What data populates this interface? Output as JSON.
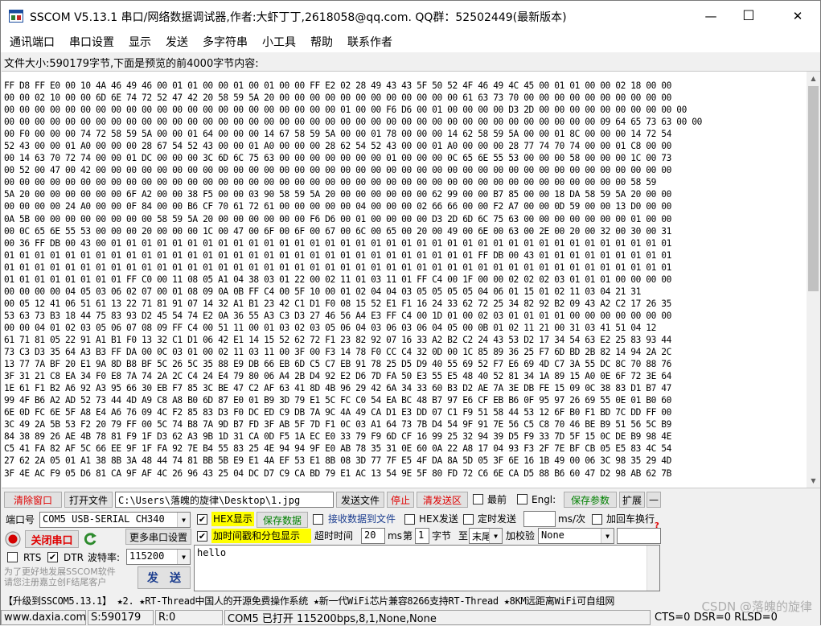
{
  "window": {
    "title": "SSCOM V5.13.1 串口/网络数据调试器,作者:大虾丁丁,2618058@qq.com. QQ群：52502449(最新版本)",
    "minimize": "—",
    "maximize": "☐",
    "close": "✕"
  },
  "menu": [
    "通讯端口",
    "串口设置",
    "显示",
    "发送",
    "多字符串",
    "小工具",
    "帮助",
    "联系作者"
  ],
  "info_line": "文件大小:590179字节,下面是预览的前4000字节内容:",
  "hex_lines": [
    "FF D8 FF E0 00 10 4A 46 49 46 00 01 01 00 00 01 00 01 00 00 FF E2 02 28 49 43 43 5F 50 52 4F 46 49 4C 45 00 01 01 00 00 02 18 00 00",
    "00 00 02 10 00 00 6D 6E 74 72 52 47 42 20 58 59 5A 20 00 00 00 00 00 00 00 00 00 00 00 00 61 63 73 70 00 00 00 00 00 00 00 00 00 00",
    "00 00 00 00 00 00 00 00 00 00 00 00 00 00 00 00 00 00 00 00 00 00 01 00 00 F6 D6 00 01 00 00 00 00 D3 2D 00 00 00 00 00 00 00 00 00 00",
    "00 00 00 00 00 00 00 00 00 00 00 00 00 00 00 00 00 00 00 00 00 00 00 00 00 00 00 00 00 00 00 00 00 00 00 00 00 00 00 09 64 65 73 63 00 00",
    "00 F0 00 00 00 74 72 58 59 5A 00 00 01 64 00 00 00 14 67 58 59 5A 00 00 01 78 00 00 00 14 62 58 59 5A 00 00 01 8C 00 00 00 14 72 54",
    "52 43 00 00 01 A0 00 00 00 28 67 54 52 43 00 00 01 A0 00 00 00 28 62 54 52 43 00 00 01 A0 00 00 00 28 77 74 70 74 00 00 01 C8 00 00",
    "00 14 63 70 72 74 00 00 01 DC 00 00 00 3C 6D 6C 75 63 00 00 00 00 00 00 00 01 00 00 00 0C 65 6E 55 53 00 00 00 58 00 00 00 1C 00 73",
    "00 52 00 47 00 42 00 00 00 00 00 00 00 00 00 00 00 00 00 00 00 00 00 00 00 00 00 00 00 00 00 00 00 00 00 00 00 00 00 00 00 00 00 00",
    "00 00 00 00 00 00 00 00 00 00 00 00 00 00 00 00 00 00 00 00 00 00 00 00 00 00 00 00 00 00 00 00 00 00 00 00 00 00 00 00 00 58 59",
    "5A 20 00 00 00 00 00 00 6F A2 00 00 38 F5 00 00 03 90 58 59 5A 20 00 00 00 00 00 00 62 99 00 00 B7 85 00 00 18 DA 58 59 5A 20 00 00",
    "00 00 00 00 24 A0 00 00 0F 84 00 00 B6 CF 70 61 72 61 00 00 00 00 00 04 00 00 00 02 66 66 00 00 F2 A7 00 00 0D 59 00 00 13 D0 00 00",
    "0A 5B 00 00 00 00 00 00 00 00 58 59 5A 20 00 00 00 00 00 00 F6 D6 00 01 00 00 00 00 D3 2D 6D 6C 75 63 00 00 00 00 00 00 00 01 00 00",
    "00 0C 65 6E 55 53 00 00 00 20 00 00 00 1C 00 47 00 6F 00 6F 00 67 00 6C 00 65 00 20 00 49 00 6E 00 63 00 2E 00 20 00 32 00 30 00 31",
    "00 36 FF DB 00 43 00 01 01 01 01 01 01 01 01 01 01 01 01 01 01 01 01 01 01 01 01 01 01 01 01 01 01 01 01 01 01 01 01 01 01 01 01 01",
    "01 01 01 01 01 01 01 01 01 01 01 01 01 01 01 01 01 01 01 01 01 01 01 01 01 01 01 01 01 01 01 FF DB 00 43 01 01 01 01 01 01 01 01 01",
    "01 01 01 01 01 01 01 01 01 01 01 01 01 01 01 01 01 01 01 01 01 01 01 01 01 01 01 01 01 01 01 01 01 01 01 01 01 01 01 01 01 01 01 01",
    "01 01 01 01 01 01 01 01 FF C0 00 11 08 05 A1 04 38 03 01 22 00 02 11 01 03 11 01 FF C4 00 1F 00 00 02 02 02 03 01 01 01 00 00 00 00",
    "00 00 00 00 04 05 03 06 02 07 00 01 08 09 0A 0B FF C4 00 5F 10 00 01 02 04 04 03 05 05 05 05 04 06 01 15 01 02 11 03 04 21 31",
    "00 05 12 41 06 51 61 13 22 71 81 91 07 14 32 A1 B1 23 42 C1 D1 F0 08 15 52 E1 F1 16 24 33 62 72 25 34 82 92 B2 09 43 A2 C2 17 26 35",
    "53 63 73 B3 18 44 75 83 93 D2 45 54 74 E2 0A 36 55 A3 C3 D3 27 46 56 A4 E3 FF C4 00 1D 01 00 02 03 01 01 01 01 00 00 00 00 00 00 00",
    "00 00 04 01 02 03 05 06 07 08 09 FF C4 00 51 11 00 01 03 02 03 05 06 04 03 06 03 06 04 05 00 0B 01 02 11 21 00 31 03 41 51 04 12",
    "61 71 81 05 22 91 A1 B1 F0 13 32 C1 D1 06 42 E1 14 15 52 62 72 F1 23 82 92 07 16 33 A2 B2 C2 24 43 53 D2 17 34 54 63 E2 25 83 93 44",
    "73 C3 D3 35 64 A3 B3 FF DA 00 0C 03 01 00 02 11 03 11 00 3F 00 F3 14 78 F0 CC C4 32 0D 00 1C 85 89 36 25 F7 6D BD 2B 82 14 94 2A 2C",
    "13 77 7A BF 20 E1 9A 8D B8 BF 5C 26 5C 35 88 E9 DB 66 EB 6D C5 C7 EB 91 78 25 D5 D9 40 55 69 52 F7 E6 69 4D C7 3A 55 DC 8C 70 88 76",
    "3F 31 21 C8 EA 34 F0 E8 7A 74 2A 2C C4 24 E4 79 80 06 A4 2B D4 92 E2 D6 7D FA 50 E3 55 E5 48 40 52 81 34 1A 89 15 A0 0E 6F 72 3E 64",
    "1E 61 F1 B2 A6 92 A3 95 66 30 EB F7 85 3C BE 47 C2 AF 63 41 8D 4B 96 29 42 6A 34 33 60 B3 D2 AE 7A 3E DB FE 15 09 0C 38 83 D1 B7 47",
    "99 4F B6 A2 AD 52 73 44 4D A9 C8 A8 B0 6D 87 E0 01 B9 3D 79 E1 5C FC C0 54 EA BC 48 B7 97 E6 CF EB B6 0F 95 97 26 69 55 0E 01 B0 60",
    "6E 0D FC 6E 5F A8 E4 A6 76 09 4C F2 85 83 D3 F0 DC ED C9 DB 7A 9C 4A 49 CA D1 E3 DD 07 C1 F9 51 58 44 53 12 6F B0 F1 BD 7C DD FF 00",
    "3C 49 2A 5B 53 F2 20 79 FF 00 5C 74 B8 7A 9D B7 FD 3F AB 5F 7D F1 0C 03 A1 64 73 7B D4 54 9F 91 7E 56 C5 C8 70 46 BE B9 51 56 5C B9",
    "84 38 89 26 AE 4B 78 81 F9 1F D3 62 A3 9B 1D 31 CA 0D F5 1A EC E0 33 79 F9 6D CF 16 99 25 32 94 39 D5 F9 33 7D 5F 15 0C DE B9 98 4E",
    "C5 41 FA 82 AF 5C 66 EE 9F 1F FA 92 7E B4 55 83 25 4E 94 94 9F E0 AB 78 35 31 0E 60 0A 22 A8 17 04 93 F3 2F 7E BF CB 05 E5 83 4C 54",
    "27 62 2A 05 01 A1 38 8B 3A 48 44 74 81 BB 5B E9 E1 4A EF 53 E1 8B 08 3D 77 7F E5 4F DA 8A 5D 05 3F 6E 16 1B 49 00 06 3C 98 35 29 4D",
    "3F 4E AC F9 05 D6 81 CA 9F AF 4C 26 96 43 25 04 DC D7 C9 CA BD 79 E1 AC 13 54 9E 5F 80 FD 72 C6 6E CA D5 88 B6 60 47 D2 98 AB 62 7B"
  ],
  "toolbar": {
    "clear_window": "清除窗口",
    "open_file": "打开文件",
    "file_path": "C:\\Users\\落魄的旋律\\Desktop\\1.jpg",
    "send_file": "发送文件",
    "stop": "停止",
    "clear_send": "清发送区",
    "topmost": "最前",
    "english": "Engl:",
    "save_params": "保存参数",
    "expand": "扩展",
    "collapse": "—"
  },
  "port": {
    "port_label": "端口号",
    "port_value": "COM5 USB-SERIAL CH340",
    "close_port": "关闭串口",
    "more_settings": "更多串口设置",
    "rts_label": "RTS",
    "rts_checked": false,
    "dtr_label": "DTR",
    "dtr_checked": true,
    "baud_label": "波特率:",
    "baud_value": "115200",
    "promo_line1": "为了更好地发展SSCOM软件",
    "promo_line2": "请您注册嘉立创F结尾客户",
    "send": "发　送"
  },
  "options": {
    "hex_display": "HEX显示",
    "hex_display_checked": true,
    "save_data": "保存数据",
    "recv_to_file": "接收数据到文件",
    "recv_to_file_checked": false,
    "hex_send": "HEX发送",
    "hex_send_checked": false,
    "timed_send": "定时发送",
    "timed_send_checked": false,
    "interval_unit": "ms/次",
    "add_crlf": "加回车换行",
    "add_crlf_checked": false,
    "timestamp": "加时间戳和分包显示",
    "timestamp_checked": true,
    "timeout_label": "超时时间",
    "timeout_value": "20",
    "timeout_unit": "ms",
    "byte_label1": "第",
    "byte_value": "1",
    "byte_label2": "字节",
    "to_label": "至",
    "to_value": "末尾",
    "checksum_label": "加校验",
    "checksum_value": "None",
    "help_mark": "?"
  },
  "send_text": "hello",
  "ticker": "【升级到SSCOM5.13.1】 ★2.  ★RT-Thread中国人的开源免费操作系统  ★新一代WiFi芯片兼容8266支持RT-Thread  ★8KM远距离WiFi可自组网",
  "status": {
    "website": "www.daxia.com",
    "sent": "S:590179",
    "received": "R:0",
    "port_status": "COM5 已打开  115200bps,8,1,None,None",
    "lines": "CTS=0 DSR=0 RLSD=0"
  },
  "watermark": "CSDN @落魄的旋律",
  "colors": {
    "hex_highlight": "#ffff00",
    "accent_red": "#e00000",
    "accent_green": "#008000"
  }
}
